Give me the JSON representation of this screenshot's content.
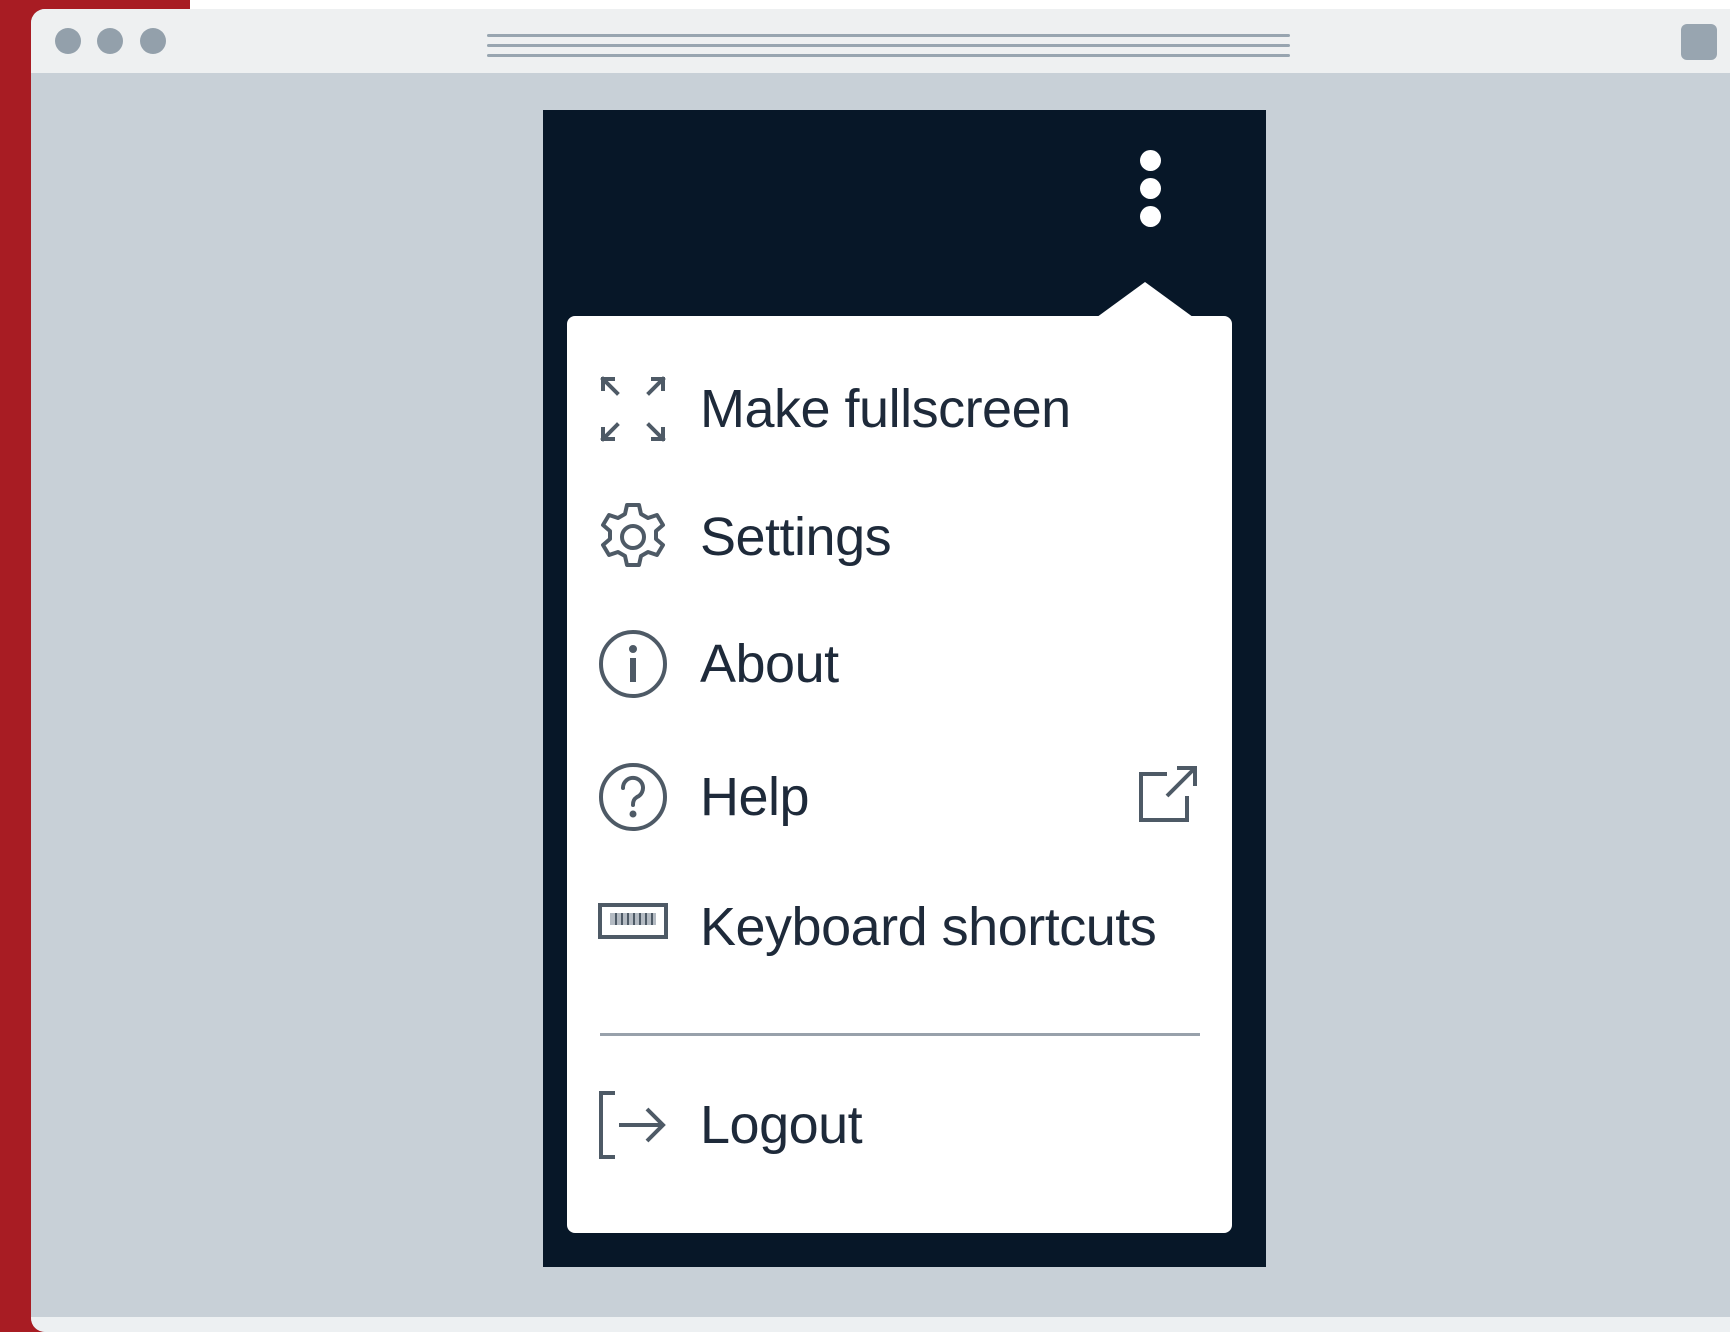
{
  "window": {
    "controls": [
      "close-dot",
      "minimize-dot",
      "maximize-dot"
    ]
  },
  "header": {
    "overflow_menu_icon": "kebab-vertical-icon"
  },
  "menu": {
    "items": [
      {
        "label": "Make fullscreen",
        "icon": "fullscreen-icon"
      },
      {
        "label": "Settings",
        "icon": "gear-icon"
      },
      {
        "label": "About",
        "icon": "info-icon"
      },
      {
        "label": "Help",
        "icon": "help-icon",
        "trailing_icon": "external-link-icon"
      },
      {
        "label": "Keyboard shortcuts",
        "icon": "keyboard-icon"
      }
    ],
    "logout": {
      "label": "Logout",
      "icon": "logout-icon"
    }
  },
  "colors": {
    "frame_red": "#a81c23",
    "window_background": "#c8d0d7",
    "app_navy": "#071728",
    "menu_text": "#1e2a3a",
    "icon_gray": "#4e5a66"
  }
}
